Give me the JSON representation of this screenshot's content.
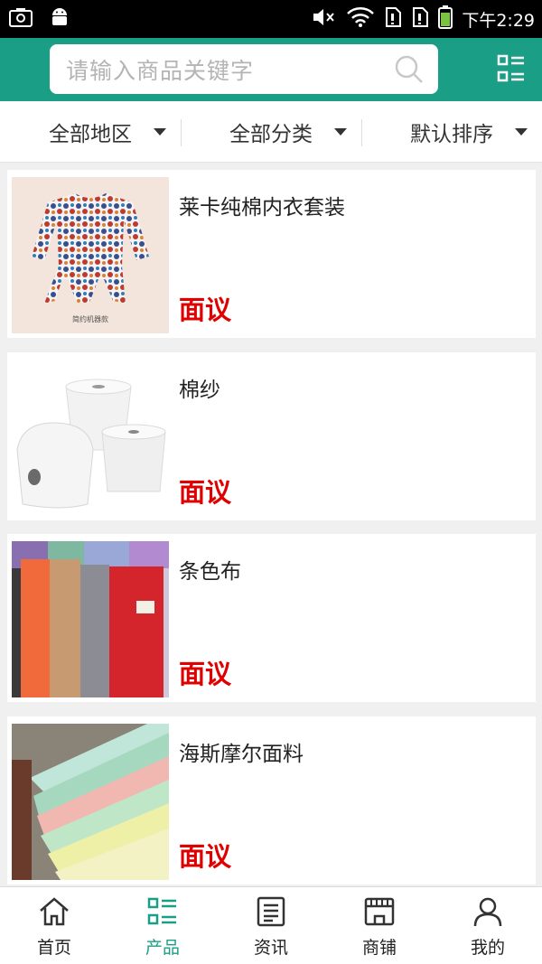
{
  "status_bar": {
    "time": "下午2:29"
  },
  "search": {
    "placeholder": "请输入商品关键字"
  },
  "filters": [
    {
      "label": "全部地区"
    },
    {
      "label": "全部分类"
    },
    {
      "label": "默认排序"
    }
  ],
  "products": [
    {
      "title": "莱卡纯棉内衣套装",
      "price": "面议",
      "image_caption": "简约机器款"
    },
    {
      "title": "棉纱",
      "price": "面议"
    },
    {
      "title": "条色布",
      "price": "面议"
    },
    {
      "title": "海斯摩尔面料",
      "price": "面议"
    }
  ],
  "tabs": [
    {
      "label": "首页",
      "icon": "home-icon"
    },
    {
      "label": "产品",
      "icon": "product-list-icon",
      "active": true
    },
    {
      "label": "资讯",
      "icon": "news-icon"
    },
    {
      "label": "商铺",
      "icon": "store-icon"
    },
    {
      "label": "我的",
      "icon": "user-icon"
    }
  ],
  "colors": {
    "accent": "#1b9e86",
    "price": "#e00000"
  }
}
